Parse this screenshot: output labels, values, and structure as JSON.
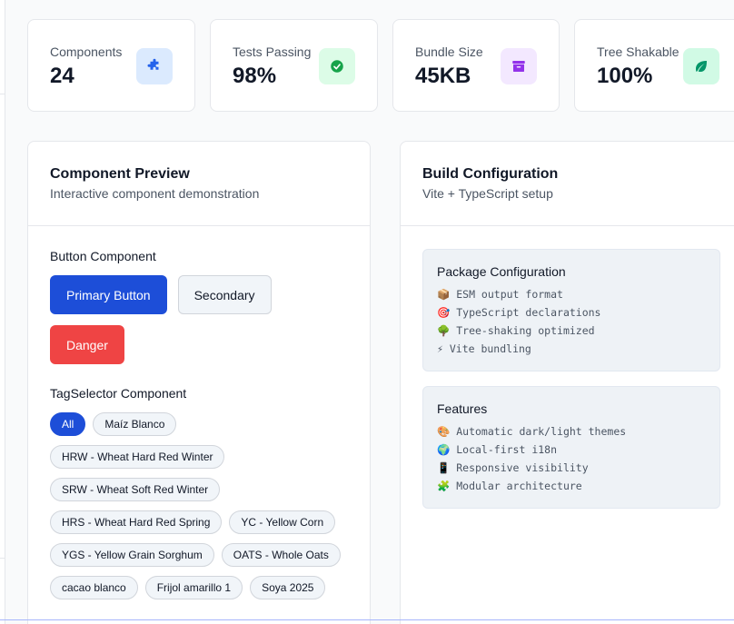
{
  "stats": [
    {
      "label": "Components",
      "value": "24",
      "icon": "puzzle-icon",
      "icon_bg": "#dbeafe",
      "icon_color": "#2563eb"
    },
    {
      "label": "Tests Passing",
      "value": "98%",
      "icon": "check-circle-icon",
      "icon_bg": "#dcfce7",
      "icon_color": "#16a34a"
    },
    {
      "label": "Bundle Size",
      "value": "45KB",
      "icon": "archive-icon",
      "icon_bg": "#f3e8ff",
      "icon_color": "#9333ea"
    },
    {
      "label": "Tree Shakable",
      "value": "100%",
      "icon": "leaf-icon",
      "icon_bg": "#d1fae5",
      "icon_color": "#059669"
    }
  ],
  "preview": {
    "title": "Component Preview",
    "subtitle": "Interactive component demonstration",
    "button_section": "Button Component",
    "buttons": {
      "primary": "Primary Button",
      "secondary": "Secondary",
      "danger": "Danger"
    },
    "tag_section": "TagSelector Component",
    "tags": [
      "All",
      "Maíz Blanco",
      "HRW - Wheat Hard Red Winter",
      "SRW - Wheat Soft Red Winter",
      "HRS - Wheat Hard Red Spring",
      "YC - Yellow Corn",
      "YGS - Yellow Grain Sorghum",
      "OATS - Whole Oats",
      "cacao blanco",
      "Frijol amarillo 1",
      "Soya 2025"
    ],
    "active_tag": "All"
  },
  "build": {
    "title": "Build Configuration",
    "subtitle": "Vite + TypeScript setup",
    "package": {
      "title": "Package Configuration",
      "lines": [
        "📦 ESM output format",
        "🎯 TypeScript declarations",
        "🌳 Tree-shaking optimized",
        "⚡ Vite bundling"
      ]
    },
    "features": {
      "title": "Features",
      "lines": [
        "🎨 Automatic dark/light themes",
        "🌍 Local-first i18n",
        "📱 Responsive visibility",
        "🧩 Modular architecture"
      ]
    }
  },
  "colors": {
    "primary": "#1d4ed8",
    "danger": "#ef4444",
    "border": "#e5e7eb"
  }
}
